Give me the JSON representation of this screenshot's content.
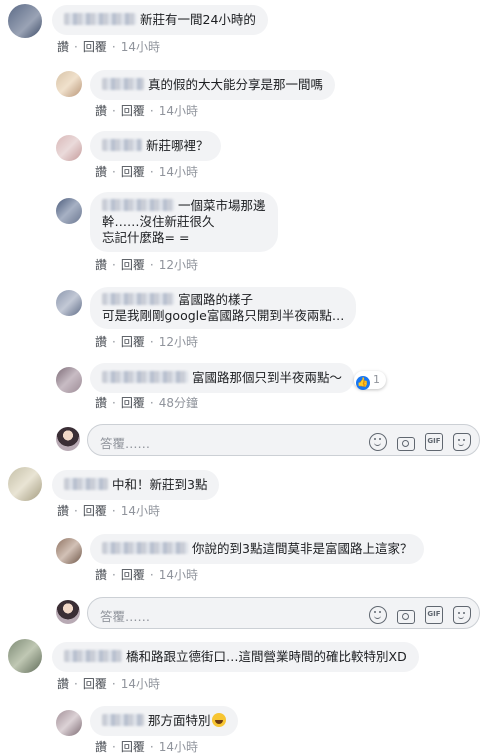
{
  "actions": {
    "like": "讚",
    "reply": "回覆"
  },
  "reply_placeholder": "答覆……",
  "comments": [
    {
      "text": "新莊有一間24小時的",
      "time": "14小時"
    },
    {
      "text": "真的假的大大能分享是那一間嗎",
      "time": "14小時"
    },
    {
      "text": "新莊哪裡？",
      "time": "14小時"
    },
    {
      "line1": "一個菜市場那邊",
      "line2": "幹……沒住新莊很久",
      "line3": "忘記什麼路= =",
      "time": "12小時"
    },
    {
      "line1": "富國路的樣子",
      "line2": "可是我剛剛google富國路只開到半夜兩點…",
      "time": "12小時"
    },
    {
      "text": "富國路那個只到半夜兩點～",
      "time": "48分鐘",
      "likes": "1"
    },
    {
      "text": "中和！新莊到3點",
      "time": "14小時"
    },
    {
      "text": "你說的到3點這間莫非是富國路上這家？",
      "time": "14小時"
    },
    {
      "text": "橋和路跟立德街口…這間營業時間的確比較特別XD",
      "time": "14小時"
    },
    {
      "text": "那方面特別",
      "time": "14小時"
    }
  ],
  "icons": [
    "smile-icon",
    "camera-icon",
    "gif-icon",
    "sticker-icon",
    "like-icon",
    "laughing-emoji-icon"
  ]
}
